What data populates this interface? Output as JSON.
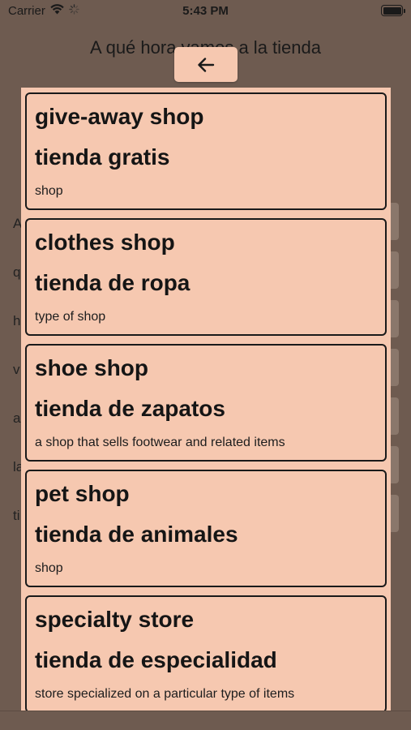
{
  "status_bar": {
    "carrier": "Carrier",
    "time": "5:43 PM",
    "icons": [
      "wifi-icon",
      "activity-spinner-icon",
      "battery-icon"
    ]
  },
  "background": {
    "title": "A qué hora vamos a la tienda",
    "row_letters": [
      "A",
      "q",
      "h",
      "v",
      "a",
      "la",
      "ti"
    ]
  },
  "back_button": {
    "icon": "arrow-left-icon"
  },
  "cards": [
    {
      "english": "give-away shop",
      "spanish": "tienda gratis",
      "description": "shop"
    },
    {
      "english": "clothes shop",
      "spanish": "tienda de ropa",
      "description": "type of shop"
    },
    {
      "english": "shoe shop",
      "spanish": "tienda de zapatos",
      "description": "a shop that sells footwear and related items"
    },
    {
      "english": "pet shop",
      "spanish": "tienda de animales",
      "description": "shop"
    },
    {
      "english": "specialty store",
      "spanish": "tienda de especialidad",
      "description": "store specialized on a particular type of items"
    }
  ],
  "colors": {
    "overlay_background": "#6e5b50",
    "card_background": "#f6c8b0",
    "card_border": "#1a1a1a"
  }
}
